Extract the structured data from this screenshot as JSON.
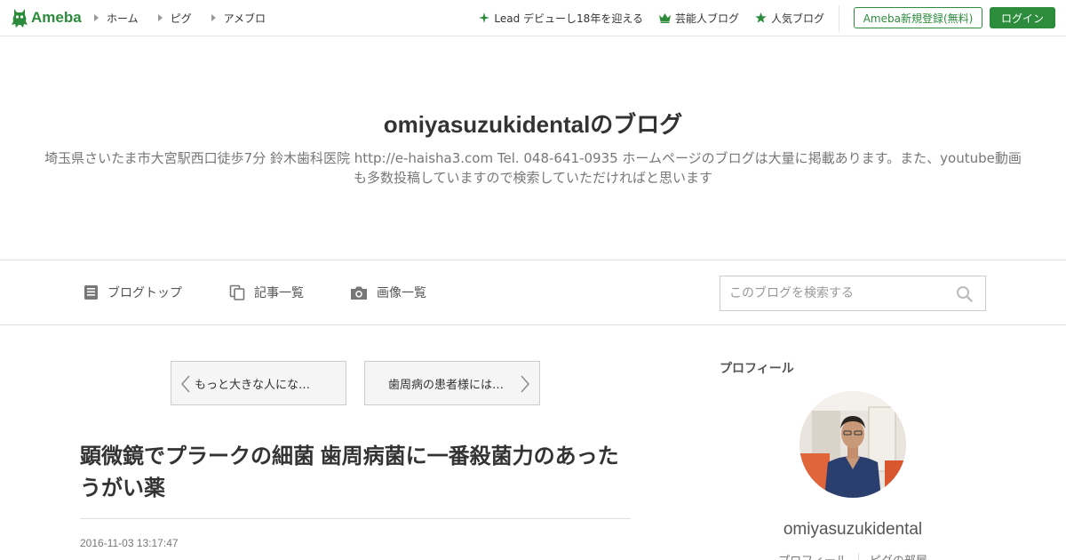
{
  "header": {
    "logo_text": "Ameba",
    "nav": [
      "ホーム",
      "ピグ",
      "アメブロ"
    ],
    "right_nav": [
      {
        "label": "Lead デビューし18年を迎える",
        "icon": "sparkle-icon"
      },
      {
        "label": "芸能人ブログ",
        "icon": "crown-icon"
      },
      {
        "label": "人気ブログ",
        "icon": "star-icon"
      }
    ],
    "register_label": "Ameba新規登録(無料)",
    "login_label": "ログイン",
    "accent": "#2d8c3c"
  },
  "blog": {
    "title": "omiyasuzukidentalのブログ",
    "description": "埼玉県さいたま市大宮駅西口徒歩7分 鈴木歯科医院 http://e-haisha3.com Tel. 048-641-0935 ホームページのブログは大量に掲載あります。また、youtube動画も多数投稿していますので検索していただければと思います"
  },
  "blog_nav": {
    "top": "ブログトップ",
    "entries": "記事一覧",
    "images": "画像一覧",
    "search_placeholder": "このブログを検索する"
  },
  "pager": {
    "prev": "もっと大きな人にな…",
    "next": "歯周病の患者様には…"
  },
  "article": {
    "title": "顕微鏡でプラークの細菌 歯周病菌に一番殺菌力のあったうがい薬",
    "date": "2016-11-03 13:17:47"
  },
  "sidebar": {
    "heading": "プロフィール",
    "name": "omiyasuzukidental",
    "links": [
      "プロフィール",
      "ピグの部屋"
    ]
  }
}
